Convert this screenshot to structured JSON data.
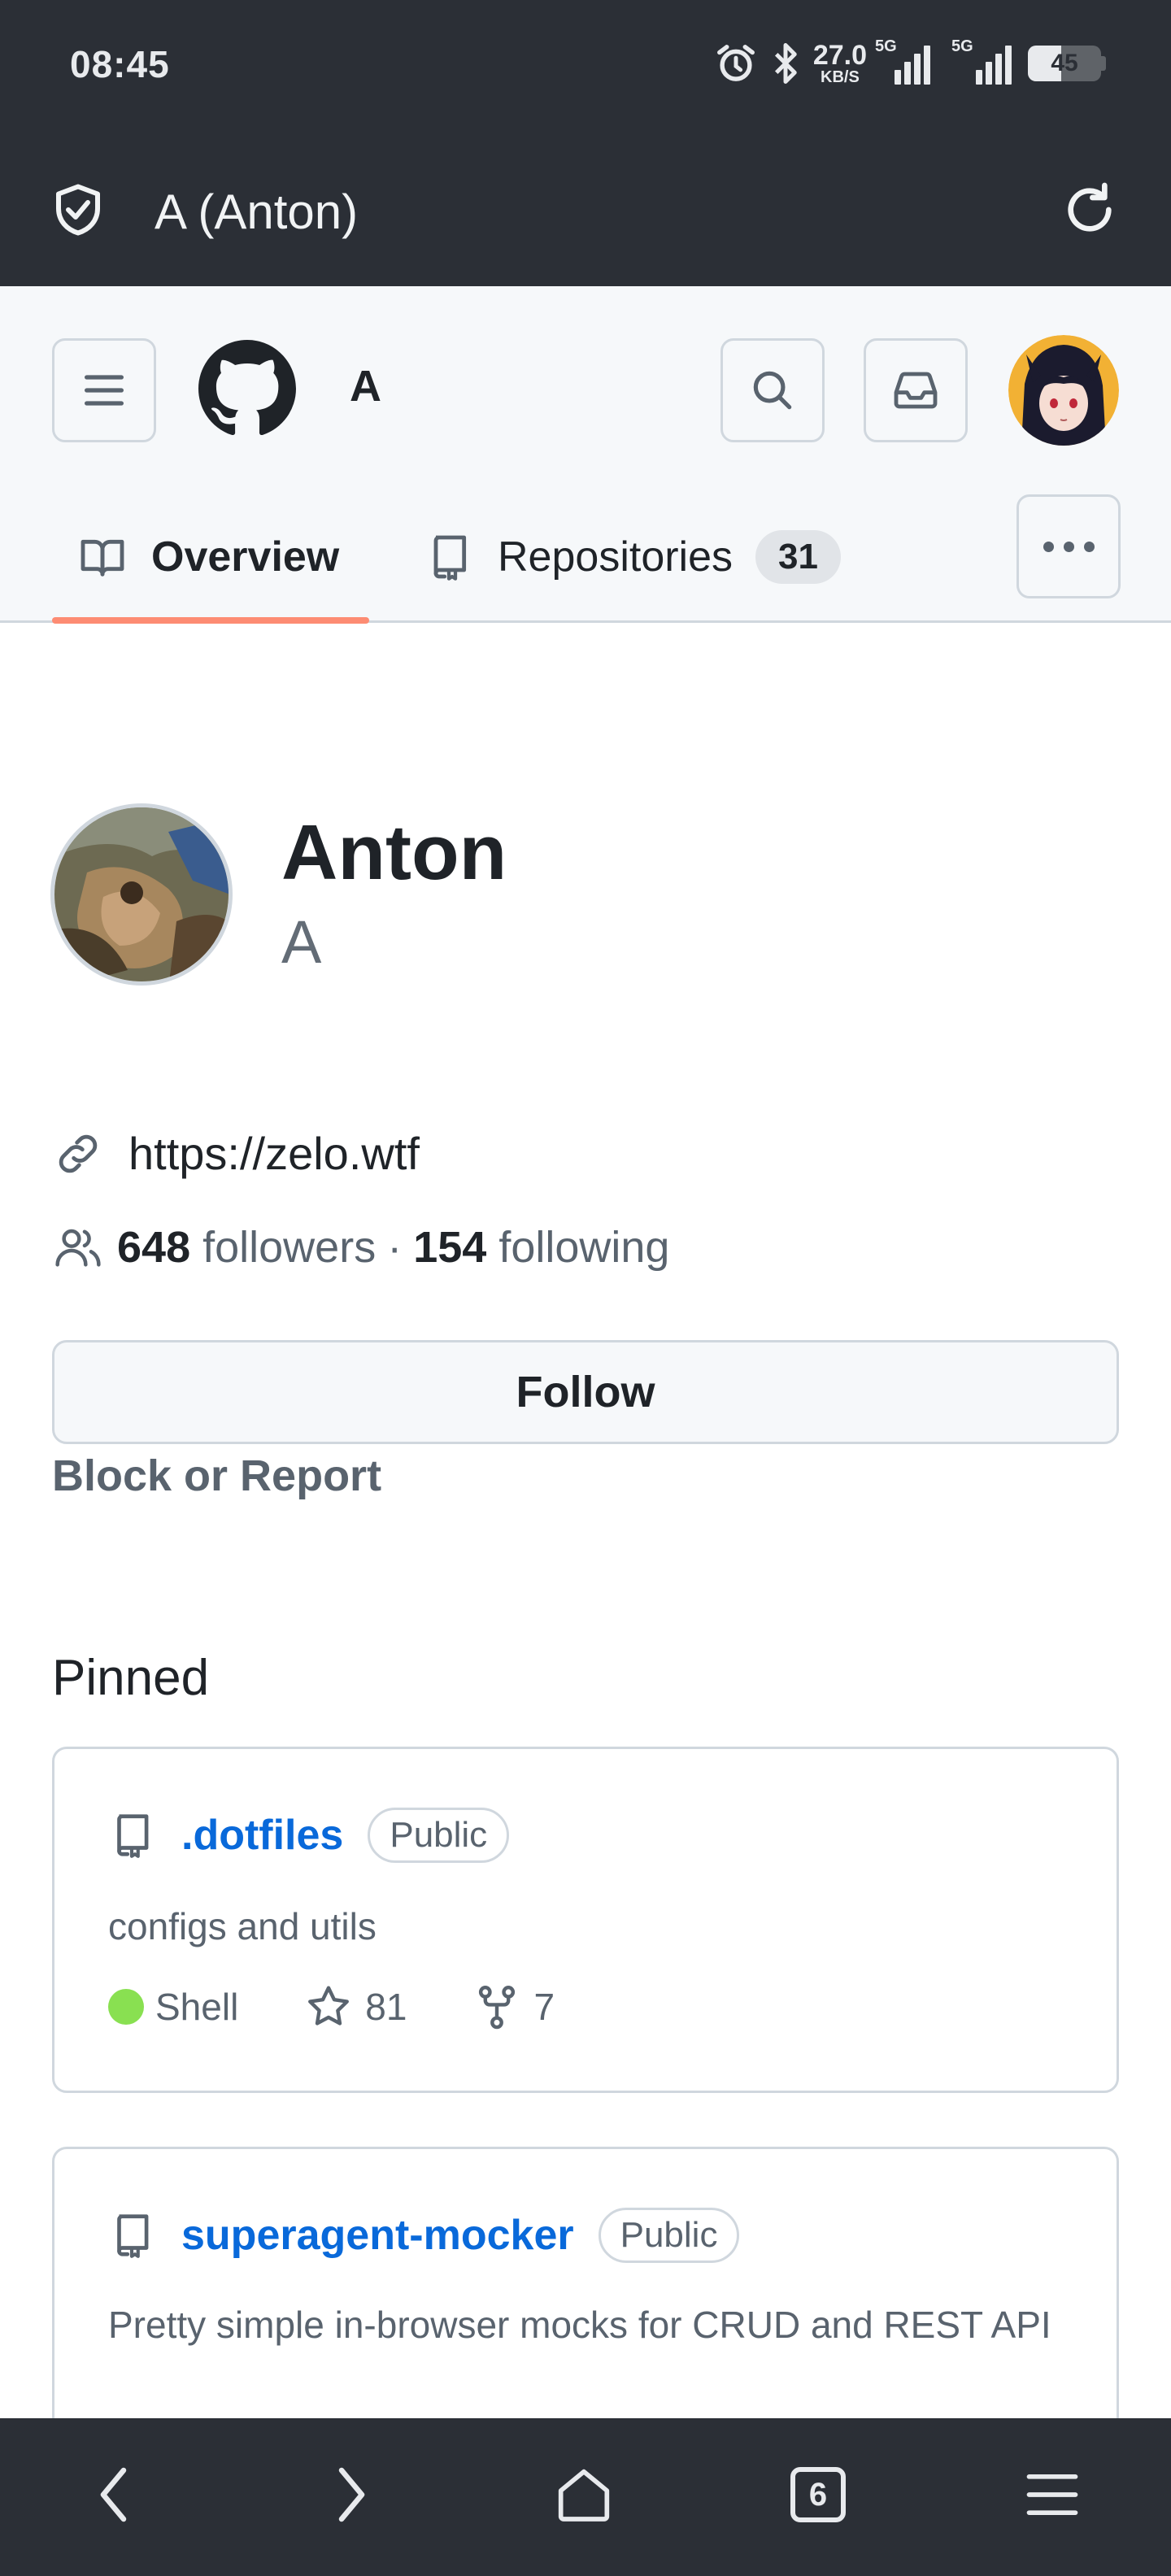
{
  "status_bar": {
    "time": "08:45",
    "net_speed": "27.0",
    "net_speed_unit": "KB/S",
    "sim1_label": "5G",
    "sim2_label": "5G",
    "battery": "45",
    "battery_level": 0.45
  },
  "custom_tab": {
    "title": "A (Anton)"
  },
  "header": {
    "username": "A",
    "tabs": [
      {
        "label": "Overview",
        "active": true
      },
      {
        "label": "Repositories",
        "count": "31"
      }
    ]
  },
  "profile": {
    "name": "Anton",
    "login": "A",
    "website": "https://zelo.wtf",
    "followers_count": "648",
    "followers_label": "followers",
    "separator": "·",
    "following_count": "154",
    "following_label": "following",
    "follow_label": "Follow",
    "block_label": "Block or Report"
  },
  "pinned": {
    "title": "Pinned",
    "repos": [
      {
        "name": ".dotfiles",
        "visibility": "Public",
        "description": "configs and utils",
        "language": "Shell",
        "language_color": "#89e051",
        "stars": "81",
        "forks": "7"
      },
      {
        "name": "superagent-mocker",
        "visibility": "Public",
        "description": "Pretty simple in-browser mocks for CRUD and REST API"
      }
    ]
  },
  "bottom_nav": {
    "tab_count": "6"
  },
  "colors": {
    "chrome_bg": "#2b2f36",
    "link_blue": "#0969da",
    "tab_underline": "#fd8c73",
    "header_bg": "#f6f8fa"
  }
}
